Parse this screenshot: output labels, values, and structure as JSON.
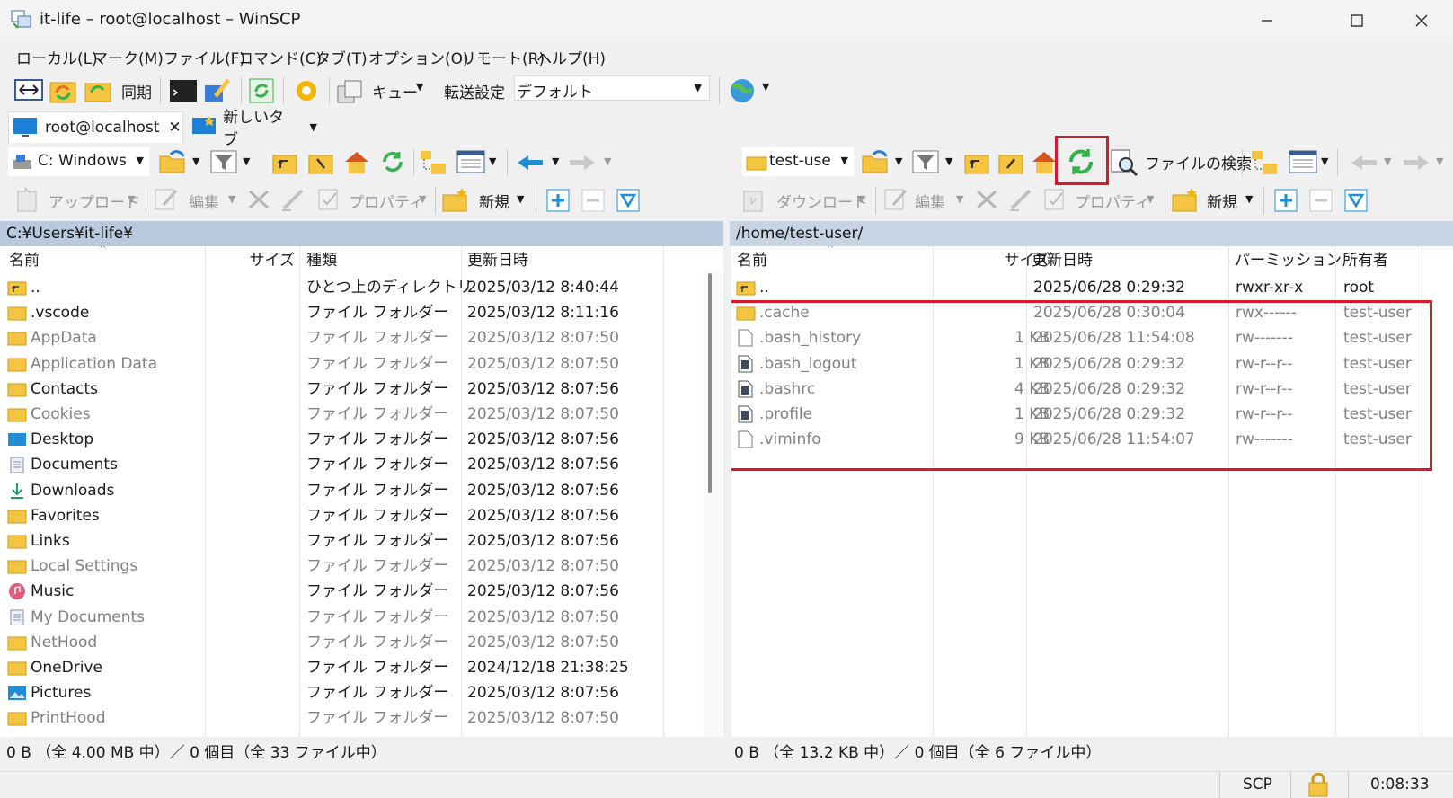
{
  "window": {
    "title": "it-life – root@localhost – WinSCP",
    "minimize": "—",
    "maximize": "☐",
    "close": "✕"
  },
  "menu": [
    "ローカル(L)",
    "マーク(M)",
    "ファイル(F)",
    "コマンド(C)",
    "タブ(T)",
    "オプション(O)",
    "リモート(R)",
    "ヘルプ(H)"
  ],
  "toolbar": {
    "sync_label": "同期",
    "queue_label": "キュー",
    "transfer_label": "転送設定",
    "transfer_value": "デフォルト"
  },
  "tabs": {
    "session": "root@localhost",
    "new_tab": "新しいタブ",
    "close": "✕"
  },
  "local": {
    "drive": "C: Windows",
    "upload_label": "アップロード",
    "edit_label": "編集",
    "properties_label": "プロパティ",
    "new_label": "新規",
    "path": "C:¥Users¥it-life¥",
    "columns": [
      "名前",
      "サイズ",
      "種類",
      "更新日時"
    ],
    "rows": [
      {
        "name": "..",
        "size": "",
        "type": "ひとつ上のディレクトリ",
        "date": "2025/03/12 8:40:44",
        "icon": "parent-folder",
        "hidden": false
      },
      {
        "name": ".vscode",
        "size": "",
        "type": "ファイル フォルダー",
        "date": "2025/03/12 8:11:16",
        "icon": "folder",
        "hidden": false
      },
      {
        "name": "AppData",
        "size": "",
        "type": "ファイル フォルダー",
        "date": "2025/03/12 8:07:50",
        "icon": "folder",
        "hidden": true
      },
      {
        "name": "Application Data",
        "size": "",
        "type": "ファイル フォルダー",
        "date": "2025/03/12 8:07:50",
        "icon": "folder",
        "hidden": true
      },
      {
        "name": "Contacts",
        "size": "",
        "type": "ファイル フォルダー",
        "date": "2025/03/12 8:07:56",
        "icon": "folder",
        "hidden": false
      },
      {
        "name": "Cookies",
        "size": "",
        "type": "ファイル フォルダー",
        "date": "2025/03/12 8:07:50",
        "icon": "folder",
        "hidden": true
      },
      {
        "name": "Desktop",
        "size": "",
        "type": "ファイル フォルダー",
        "date": "2025/03/12 8:07:56",
        "icon": "desktop",
        "hidden": false
      },
      {
        "name": "Documents",
        "size": "",
        "type": "ファイル フォルダー",
        "date": "2025/03/12 8:07:56",
        "icon": "documents",
        "hidden": false
      },
      {
        "name": "Downloads",
        "size": "",
        "type": "ファイル フォルダー",
        "date": "2025/03/12 8:07:56",
        "icon": "downloads",
        "hidden": false
      },
      {
        "name": "Favorites",
        "size": "",
        "type": "ファイル フォルダー",
        "date": "2025/03/12 8:07:56",
        "icon": "folder",
        "hidden": false
      },
      {
        "name": "Links",
        "size": "",
        "type": "ファイル フォルダー",
        "date": "2025/03/12 8:07:56",
        "icon": "folder",
        "hidden": false
      },
      {
        "name": "Local Settings",
        "size": "",
        "type": "ファイル フォルダー",
        "date": "2025/03/12 8:07:50",
        "icon": "folder",
        "hidden": true
      },
      {
        "name": "Music",
        "size": "",
        "type": "ファイル フォルダー",
        "date": "2025/03/12 8:07:56",
        "icon": "music",
        "hidden": false
      },
      {
        "name": "My Documents",
        "size": "",
        "type": "ファイル フォルダー",
        "date": "2025/03/12 8:07:50",
        "icon": "documents",
        "hidden": true
      },
      {
        "name": "NetHood",
        "size": "",
        "type": "ファイル フォルダー",
        "date": "2025/03/12 8:07:50",
        "icon": "folder",
        "hidden": true
      },
      {
        "name": "OneDrive",
        "size": "",
        "type": "ファイル フォルダー",
        "date": "2024/12/18 21:38:25",
        "icon": "folder",
        "hidden": false
      },
      {
        "name": "Pictures",
        "size": "",
        "type": "ファイル フォルダー",
        "date": "2025/03/12 8:07:56",
        "icon": "pictures",
        "hidden": false
      },
      {
        "name": "PrintHood",
        "size": "",
        "type": "ファイル フォルダー",
        "date": "2025/03/12 8:07:50",
        "icon": "folder",
        "hidden": true
      }
    ],
    "status": "0 B （全 4.00 MB 中）／ 0 個目（全 33 ファイル中）"
  },
  "remote": {
    "dir_combo": "test-use",
    "find_label": "ファイルの検索",
    "download_label": "ダウンロード",
    "edit_label": "編集",
    "properties_label": "プロパティ",
    "new_label": "新規",
    "path": "/home/test-user/",
    "columns": [
      "名前",
      "サイズ",
      "更新日時",
      "パーミッション",
      "所有者"
    ],
    "rows": [
      {
        "name": "..",
        "size": "",
        "date": "2025/06/28 0:29:32",
        "perm": "rwxr-xr-x",
        "owner": "root",
        "icon": "parent-folder",
        "hidden": false
      },
      {
        "name": ".cache",
        "size": "",
        "date": "2025/06/28 0:30:04",
        "perm": "rwx------",
        "owner": "test-user",
        "icon": "folder",
        "hidden": true
      },
      {
        "name": ".bash_history",
        "size": "1 KB",
        "date": "2025/06/28 11:54:08",
        "perm": "rw-------",
        "owner": "test-user",
        "icon": "file",
        "hidden": true
      },
      {
        "name": ".bash_logout",
        "size": "1 KB",
        "date": "2025/06/28 0:29:32",
        "perm": "rw-r--r--",
        "owner": "test-user",
        "icon": "textfile",
        "hidden": true
      },
      {
        "name": ".bashrc",
        "size": "4 KB",
        "date": "2025/06/28 0:29:32",
        "perm": "rw-r--r--",
        "owner": "test-user",
        "icon": "textfile",
        "hidden": true
      },
      {
        "name": ".profile",
        "size": "1 KB",
        "date": "2025/06/28 0:29:32",
        "perm": "rw-r--r--",
        "owner": "test-user",
        "icon": "textfile",
        "hidden": true
      },
      {
        "name": ".viminfo",
        "size": "9 KB",
        "date": "2025/06/28 11:54:07",
        "perm": "rw-------",
        "owner": "test-user",
        "icon": "file",
        "hidden": true
      }
    ],
    "status": "0 B （全 13.2 KB 中）／ 0 個目（全 6 ファイル中）"
  },
  "statusbar": {
    "protocol": "SCP",
    "time": "0:08:33"
  },
  "colors": {
    "highlight": "#d9192a",
    "folder": "#f5c542",
    "refresh_green": "#2fb34a",
    "path_local": "#b9c9de",
    "path_remote": "#c8d4e4"
  }
}
